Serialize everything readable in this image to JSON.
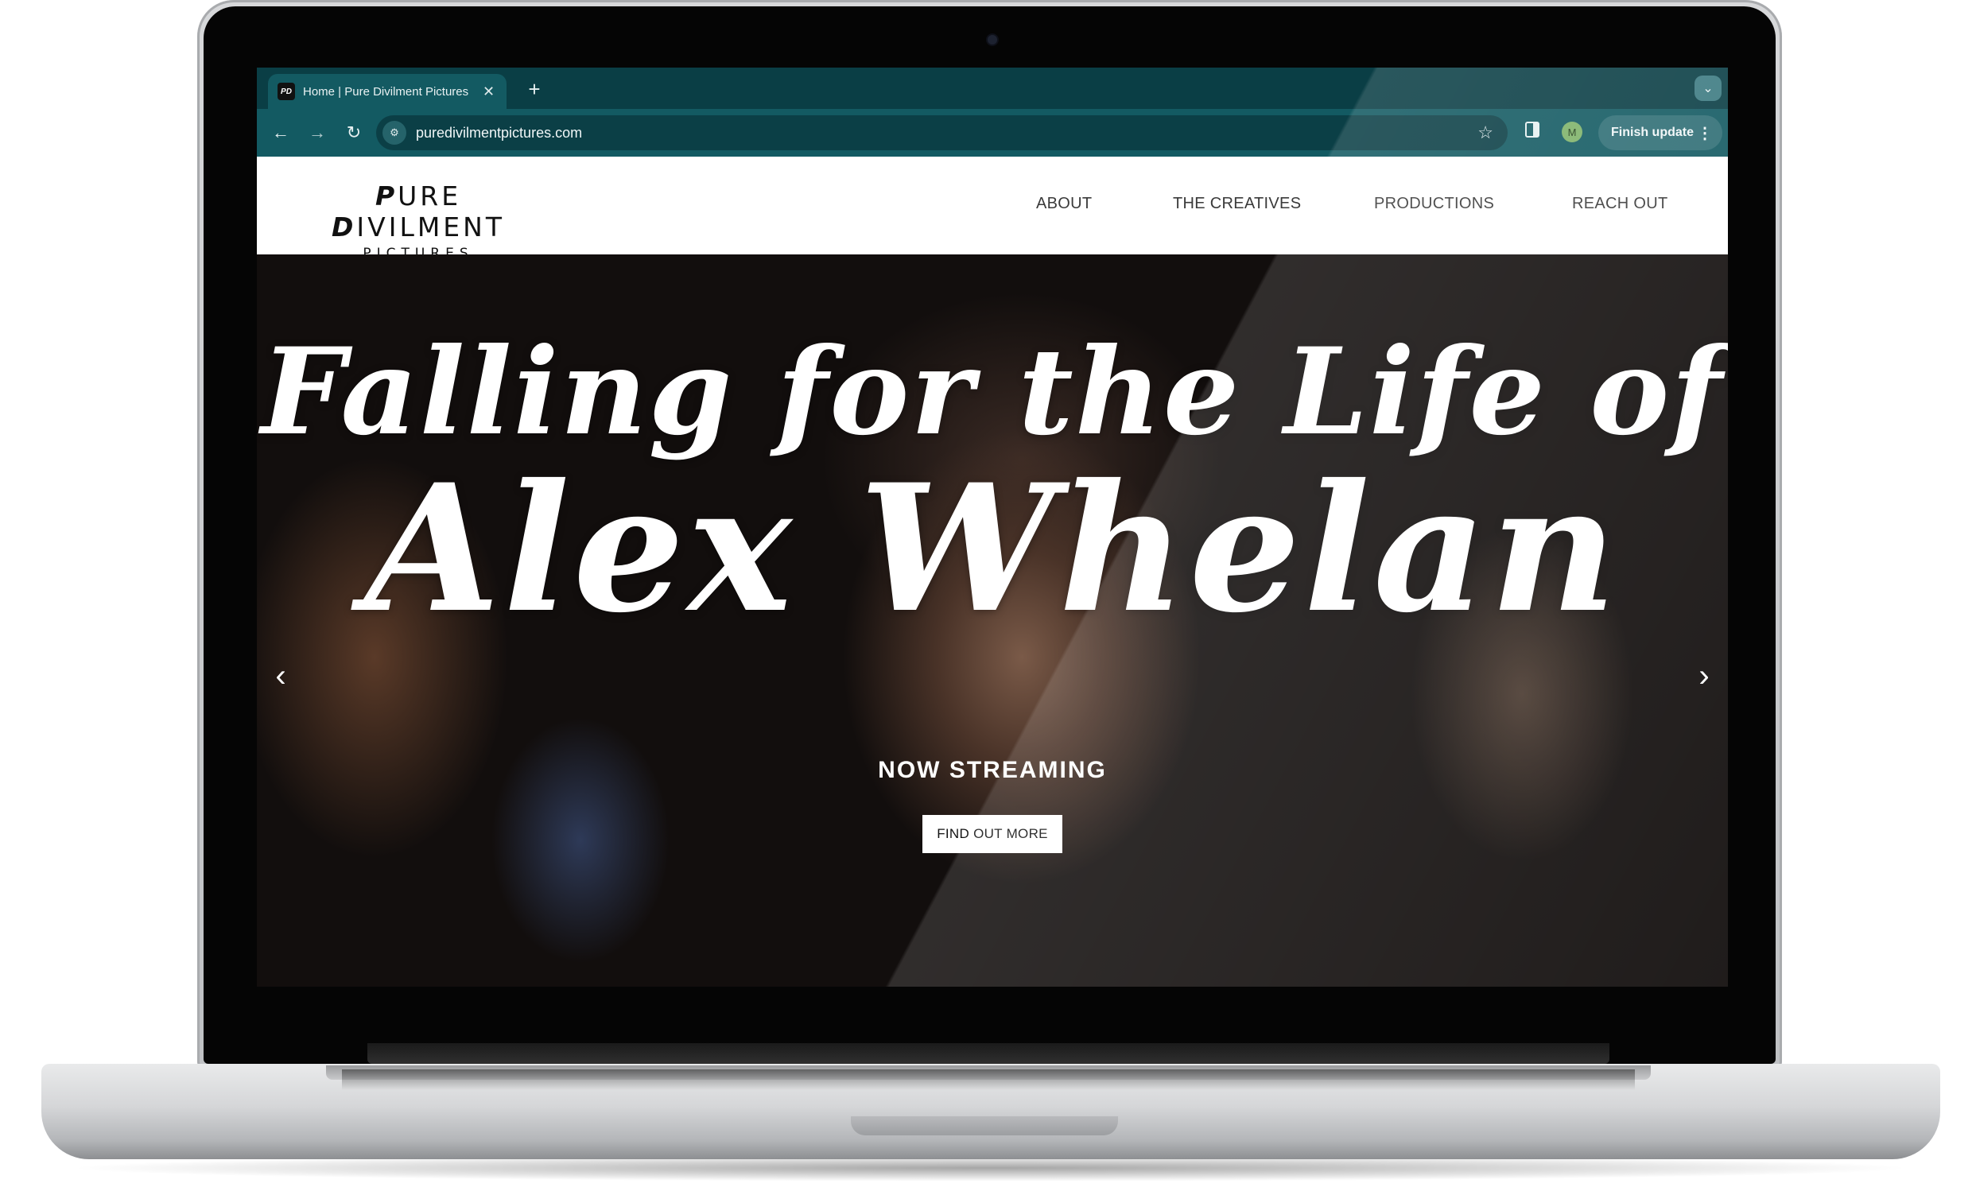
{
  "browser": {
    "tab_title": "Home | Pure Divilment Pictures",
    "favicon_text": "PD",
    "new_tab_symbol": "+",
    "tab_close_symbol": "✕",
    "url": "puredivilmentpictures.com",
    "update_button": "Finish update",
    "profile_initial": "M"
  },
  "site": {
    "logo_line1_first": "P",
    "logo_line1_mid": "URE ",
    "logo_line1_d": "D",
    "logo_line1_rest": "IVILMENT",
    "logo_line2": "PICTURES",
    "nav": [
      "ABOUT",
      "THE CREATIVES",
      "PRODUCTIONS",
      "REACH OUT"
    ]
  },
  "hero": {
    "title_line1": "Falling for the Life of",
    "title_line2": "Alex Whelan",
    "subtitle": "NOW STREAMING",
    "cta": "FIND OUT MORE"
  },
  "icons": {
    "back": "arrow-left-icon",
    "forward": "arrow-right-icon",
    "reload": "reload-icon",
    "site_info": "tune-icon",
    "bookmark": "star-icon",
    "side_panel": "side-panel-icon",
    "menu": "kebab-menu-icon",
    "tab_search": "chevron-down-icon",
    "prev_slide": "chevron-left-icon",
    "next_slide": "chevron-right-icon"
  }
}
